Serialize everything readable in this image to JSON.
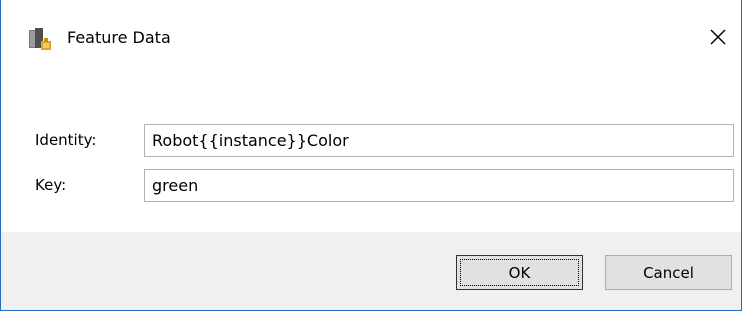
{
  "window": {
    "title": "Feature Data",
    "app_icon": "feature-data-app-icon",
    "close_icon": "close-icon"
  },
  "form": {
    "identity_label": "Identity:",
    "identity_value": "Robot{{instance}}Color",
    "key_label": "Key:",
    "key_value": "green"
  },
  "buttons": {
    "ok_label": "OK",
    "cancel_label": "Cancel"
  },
  "colors": {
    "window_border": "#1e6fbf",
    "footer_bg": "#f0f0f0",
    "button_bg": "#e1e1e1"
  }
}
